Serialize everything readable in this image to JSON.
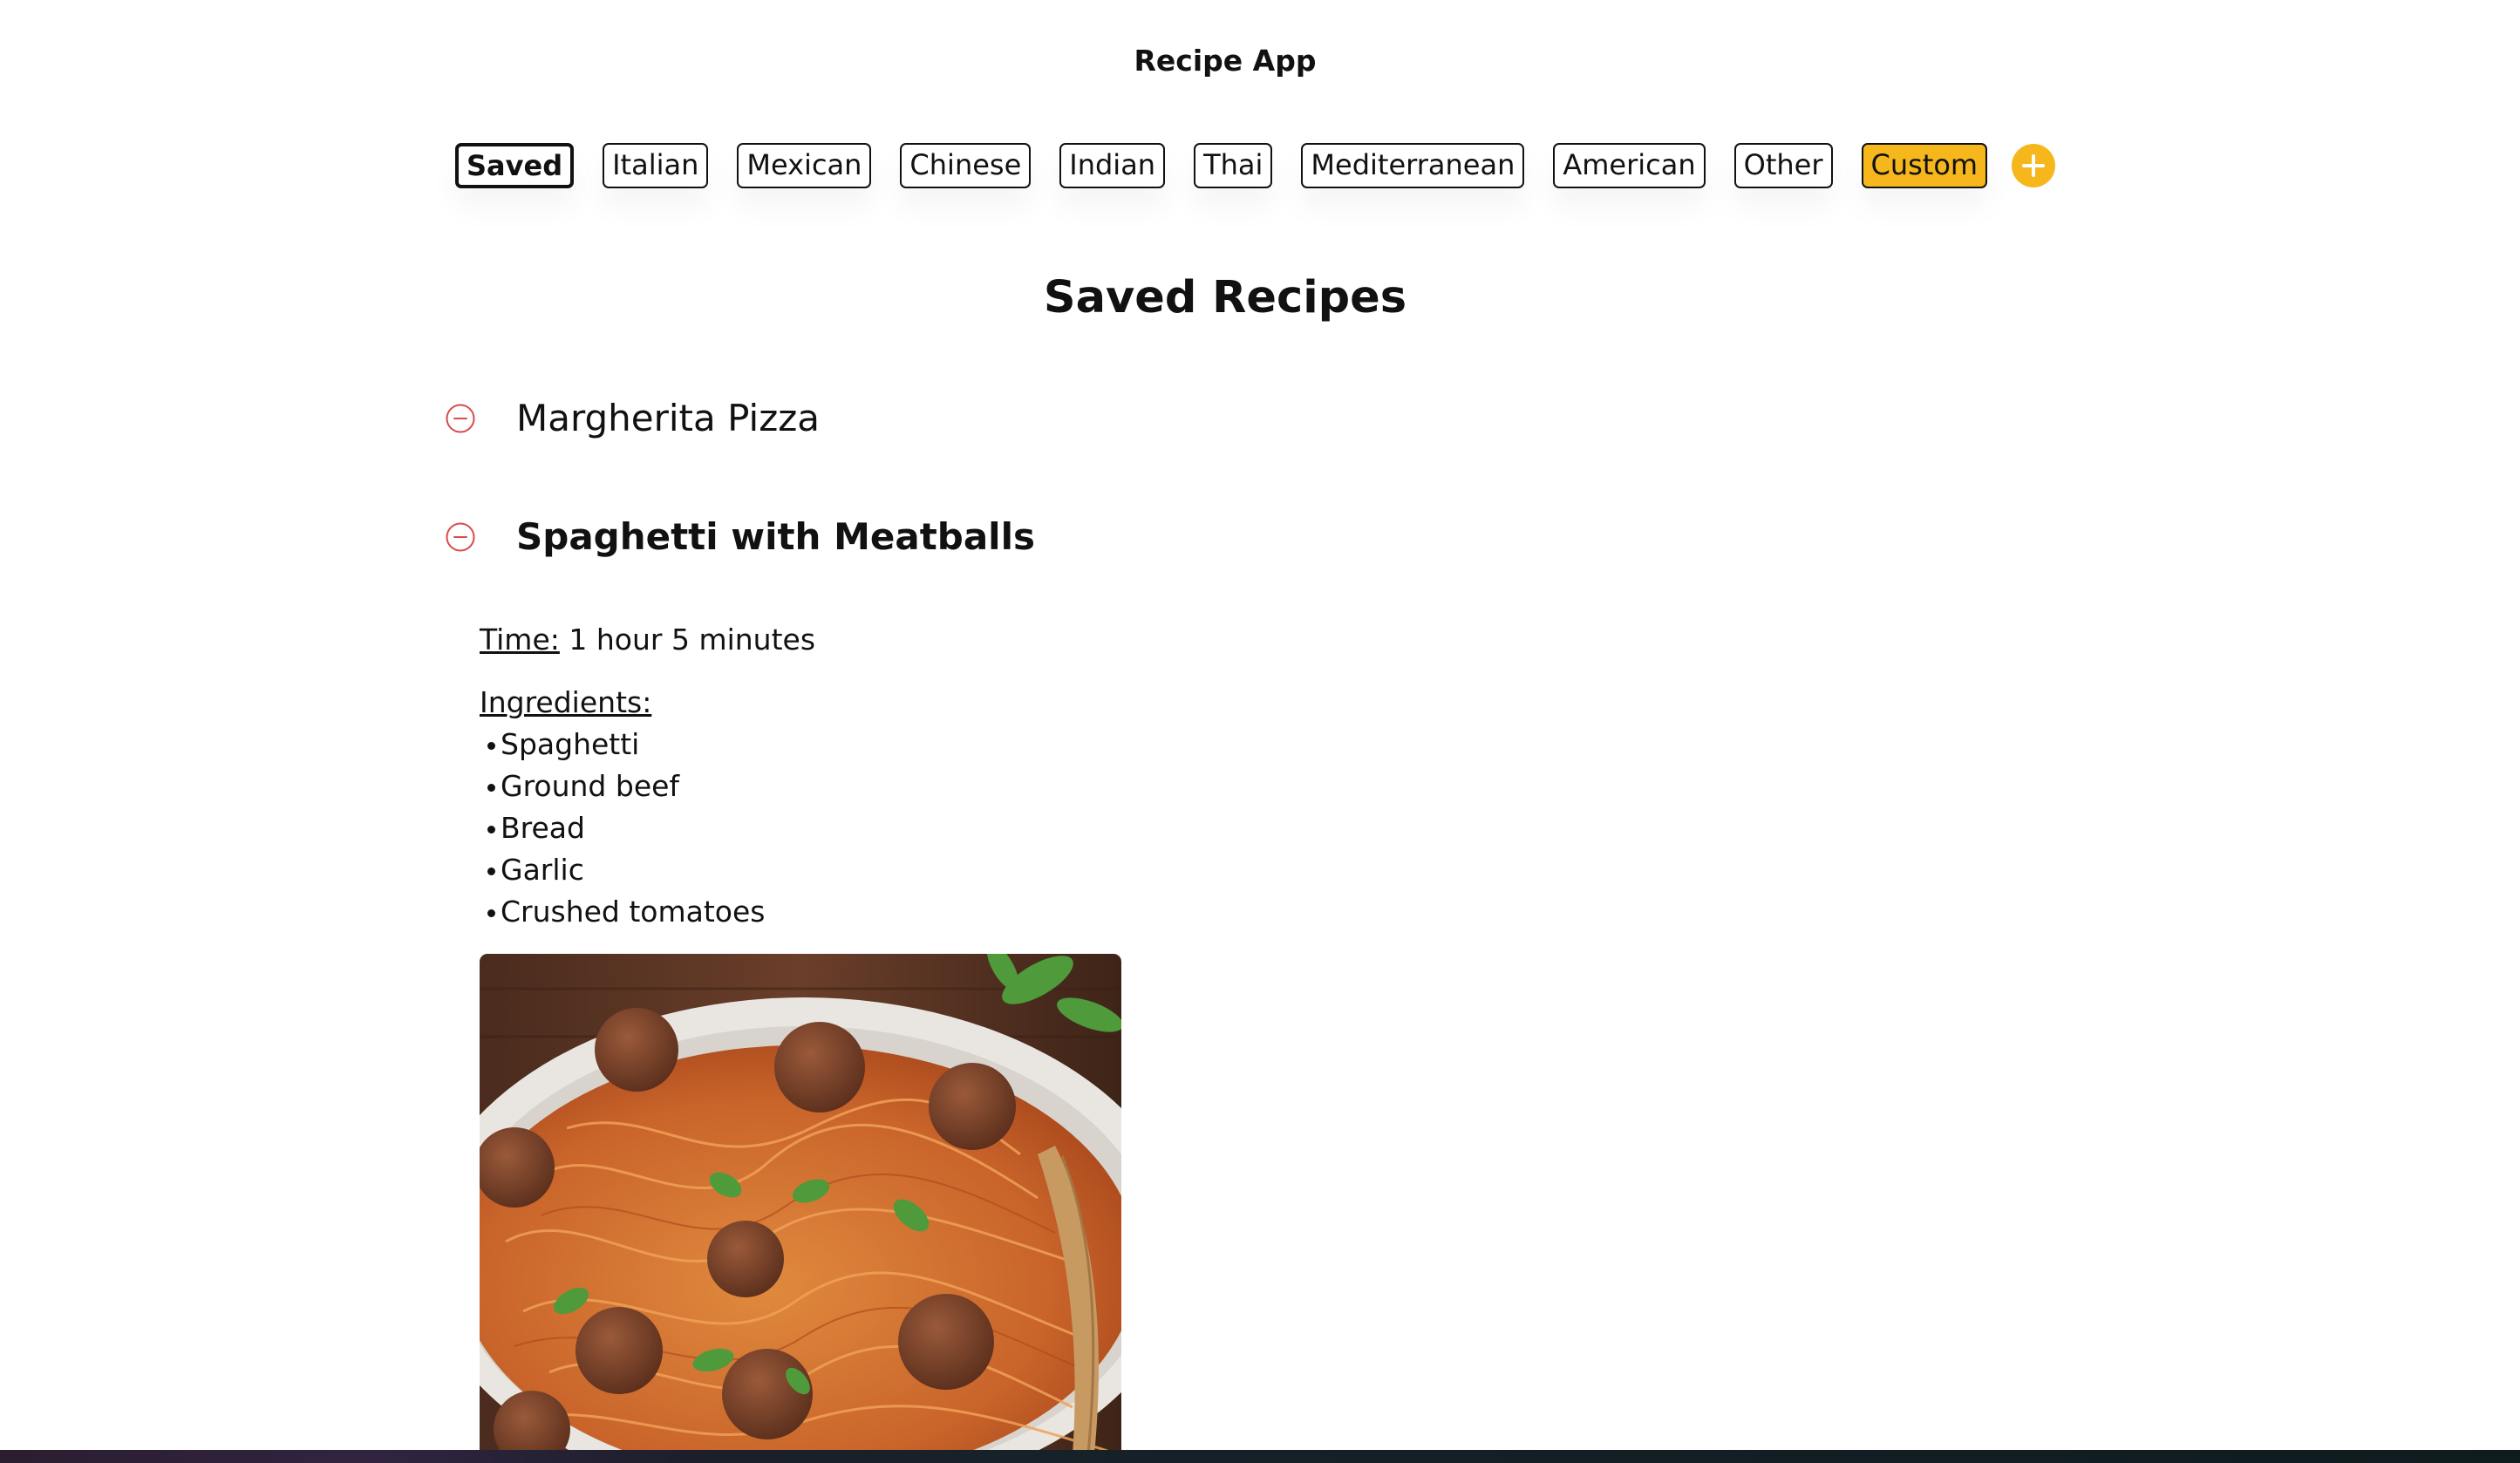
{
  "app": {
    "title": "Recipe App"
  },
  "tabs": [
    {
      "label": "Saved",
      "selected": true
    },
    {
      "label": "Italian"
    },
    {
      "label": "Mexican"
    },
    {
      "label": "Chinese"
    },
    {
      "label": "Indian"
    },
    {
      "label": "Thai"
    },
    {
      "label": "Mediterranean"
    },
    {
      "label": "American"
    },
    {
      "label": "Other"
    },
    {
      "label": "Custom",
      "highlight": true
    }
  ],
  "add_button": {
    "icon": "plus-icon"
  },
  "main": {
    "title": "Saved Recipes",
    "recipes": [
      {
        "name": "Margherita Pizza",
        "expanded": false,
        "icon": "minus-circle-icon"
      },
      {
        "name": "Spaghetti with Meatballs",
        "expanded": true,
        "icon": "minus-circle-icon",
        "time_label": "Time:",
        "time_value": "1 hour 5 minutes",
        "ingredients_label": "Ingredients:",
        "ingredients": [
          "Spaghetti",
          "Ground beef",
          "Bread",
          "Garlic",
          "Crushed tomatoes"
        ],
        "image": "spaghetti-meatballs-photo"
      }
    ]
  },
  "colors": {
    "accent": "#f6b71d",
    "remove": "#d94a4a",
    "text": "#111111",
    "background": "#ffffff"
  }
}
